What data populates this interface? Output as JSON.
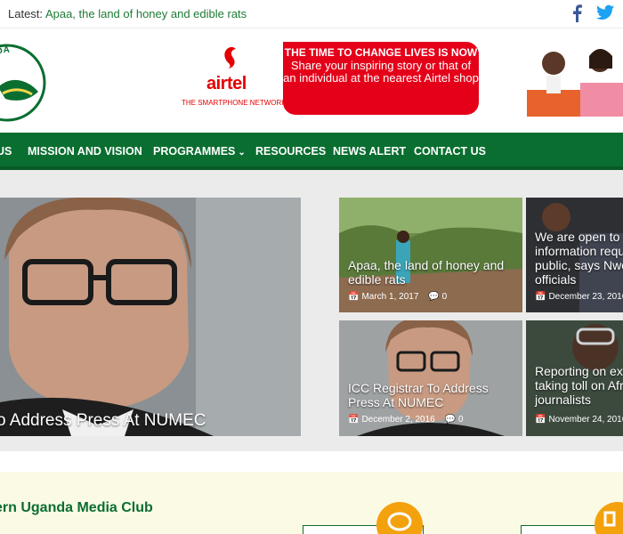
{
  "topbar": {
    "latest_label": "Latest:",
    "latest_headline": "Apaa, the land of honey and edible rats",
    "social_icons": [
      "facebook-icon",
      "twitter-icon"
    ]
  },
  "header": {
    "logo_text": "UGANDA",
    "ad": {
      "brand": "airtel",
      "tagline": "THE SMARTPHONE NETWORK",
      "headline": "THE TIME TO CHANGE LIVES IS NOW",
      "body": "Share your inspiring story or that of an individual at the nearest Airtel shop",
      "color": "#e50019"
    }
  },
  "nav": {
    "items": [
      {
        "label": "US"
      },
      {
        "label": "MISSION AND VISION"
      },
      {
        "label": "PROGRAMMES",
        "dropdown": true
      },
      {
        "label": "RESOURCES"
      },
      {
        "label": "NEWS ALERT"
      },
      {
        "label": "CONTACT US"
      }
    ],
    "color": "#0a6e30"
  },
  "featured": {
    "main_title": "o Address Press At NUMEC",
    "cards": [
      {
        "title": "Apaa, the land of honey and edible rats",
        "date": "March 1, 2017",
        "comments": "0"
      },
      {
        "title": "We are open to information requ public, says Nwo officials",
        "date": "December 23, 2016"
      },
      {
        "title": "ICC Registrar To Address Press At NUMEC",
        "date": "December 2, 2016",
        "comments": "0"
      },
      {
        "title": "Reporting on ex taking toll on Afr journalists",
        "date": "November 24, 2016"
      }
    ]
  },
  "bottom": {
    "club_title": "ern Uganda Media Club"
  }
}
